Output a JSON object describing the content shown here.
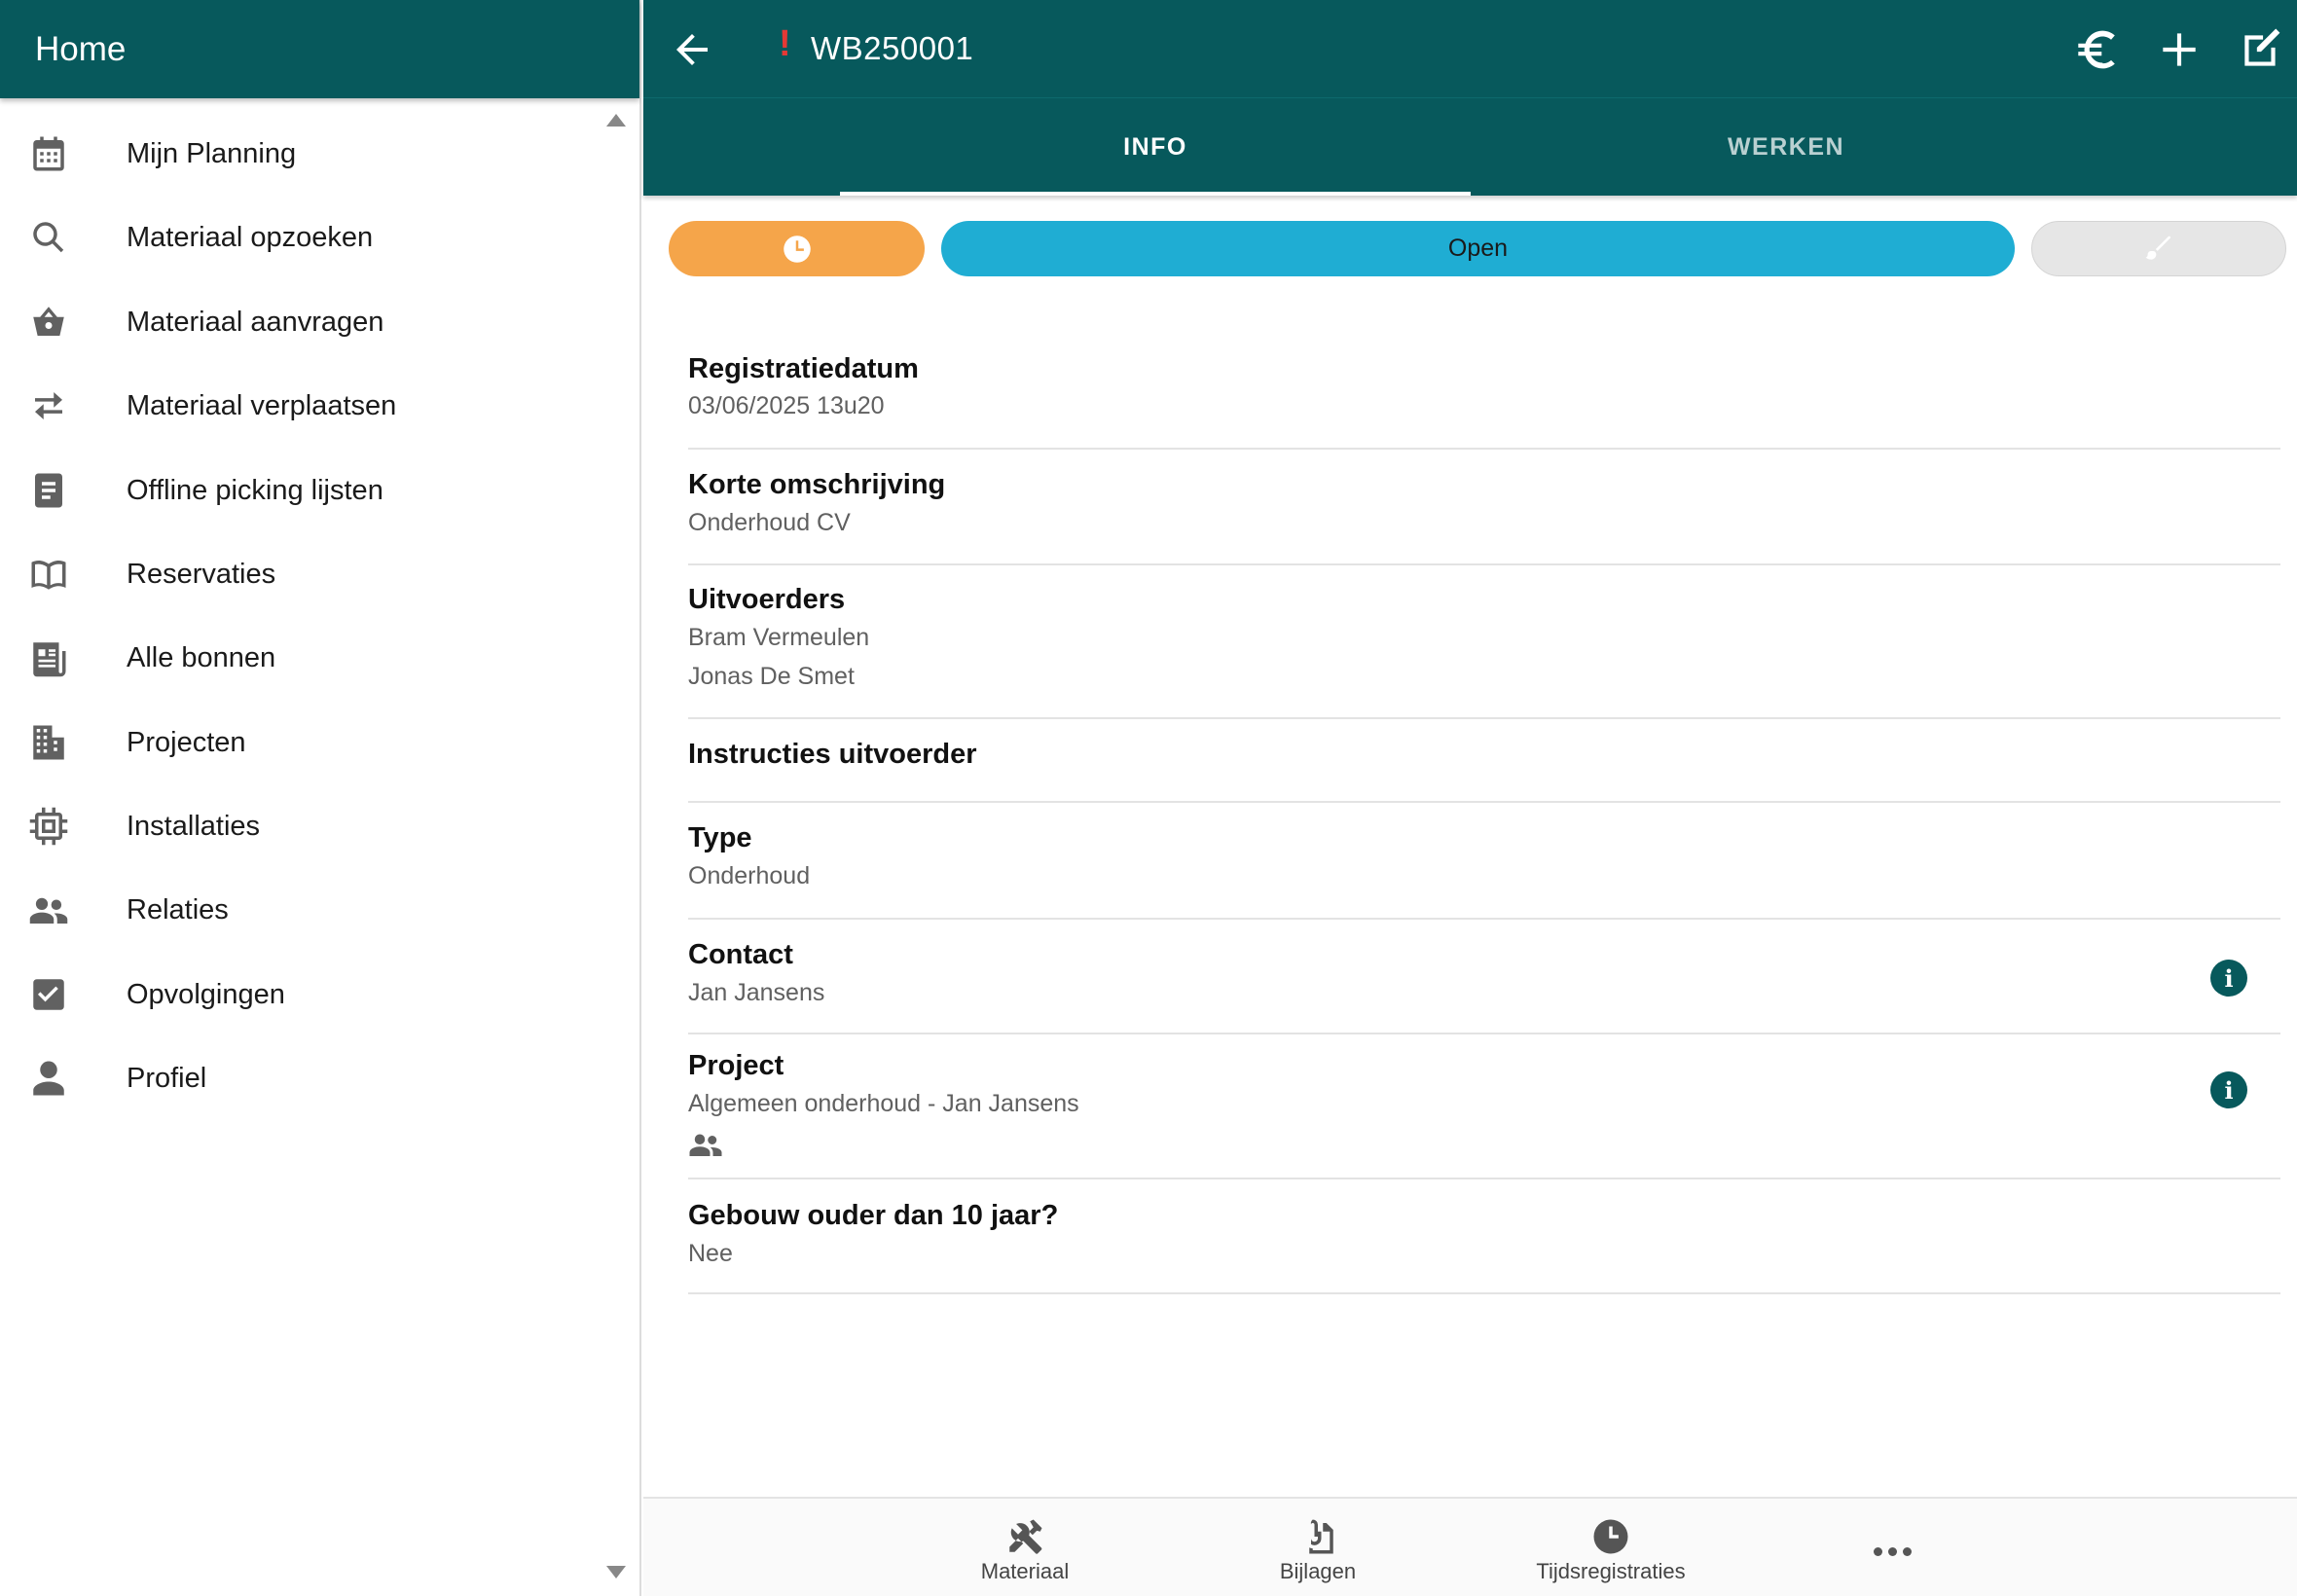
{
  "sidebar": {
    "title": "Home",
    "items": [
      {
        "label": "Mijn Planning",
        "icon": "calendar-icon"
      },
      {
        "label": "Materiaal opzoeken",
        "icon": "search-icon"
      },
      {
        "label": "Materiaal aanvragen",
        "icon": "basket-icon"
      },
      {
        "label": "Materiaal verplaatsen",
        "icon": "swap-arrows-icon"
      },
      {
        "label": "Offline picking lijsten",
        "icon": "document-icon"
      },
      {
        "label": "Reservaties",
        "icon": "book-icon"
      },
      {
        "label": "Alle bonnen",
        "icon": "newspaper-icon"
      },
      {
        "label": "Projecten",
        "icon": "building-icon"
      },
      {
        "label": "Installaties",
        "icon": "chip-icon"
      },
      {
        "label": "Relaties",
        "icon": "people-icon"
      },
      {
        "label": "Opvolgingen",
        "icon": "checkbox-icon"
      },
      {
        "label": "Profiel",
        "icon": "person-icon"
      }
    ]
  },
  "header": {
    "alert_mark": "!",
    "record_id": "WB250001",
    "actions": [
      "euro-icon",
      "plus-icon",
      "edit-icon"
    ]
  },
  "tabs": {
    "info": "INFO",
    "werken": "WERKEN",
    "active": "info"
  },
  "status": {
    "label": "Open",
    "time_color": "#f5a54a",
    "status_color": "#1fadd3"
  },
  "fields": {
    "registratiedatum": {
      "label": "Registratiedatum",
      "value": "03/06/2025 13u20"
    },
    "korte_omschrijving": {
      "label": "Korte omschrijving",
      "value": "Onderhoud CV"
    },
    "uitvoerders": {
      "label": "Uitvoerders",
      "values": [
        "Bram Vermeulen",
        "Jonas De Smet"
      ]
    },
    "instructies": {
      "label": "Instructies uitvoerder"
    },
    "type": {
      "label": "Type",
      "value": "Onderhoud"
    },
    "contact": {
      "label": "Contact",
      "value": "Jan Jansens",
      "info": "i"
    },
    "project": {
      "label": "Project",
      "value": "Algemeen onderhoud - Jan Jansens",
      "info": "i"
    },
    "gebouw": {
      "label": "Gebouw ouder dan 10 jaar?",
      "value": "Nee"
    }
  },
  "bottom_nav": {
    "materiaal": "Materiaal",
    "bijlagen": "Bijlagen",
    "tijdsregistraties": "Tijdsregistraties"
  },
  "colors": {
    "primary": "#07595c",
    "alert": "#e53935"
  }
}
